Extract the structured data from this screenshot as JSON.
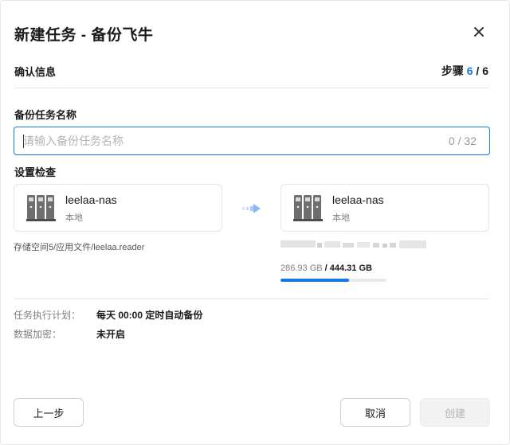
{
  "dialog": {
    "title": "新建任务 - 备份飞牛",
    "close_icon": "close-icon"
  },
  "step": {
    "label": "确认信息",
    "prefix": "步骤",
    "current": "6",
    "separator": "/",
    "total": "6"
  },
  "task_name": {
    "label": "备份任务名称",
    "value": "",
    "placeholder": "请输入备份任务名称",
    "count": "0 / 32"
  },
  "check": {
    "label": "设置检查",
    "source": {
      "name": "leelaa-nas",
      "location": "本地",
      "icon": "server-rack-icon",
      "path": "存储空间5/应用文件/leelaa.reader"
    },
    "arrow_icon": "arrow-right-icon",
    "target": {
      "name": "leelaa-nas",
      "location": "本地",
      "icon": "server-rack-icon",
      "used": "286.93 GB",
      "separator": " / ",
      "total": "444.31 GB",
      "used_fraction": 0.646
    }
  },
  "info": [
    {
      "key": "任务执行计划：",
      "value": "每天 00:00 定时自动备份"
    },
    {
      "key": "数据加密：",
      "value": "未开启"
    }
  ],
  "buttons": {
    "prev": "上一步",
    "cancel": "取消",
    "create": "创建"
  },
  "colors": {
    "accent": "#1677e6",
    "border": "#e6e6e6",
    "muted": "#808080"
  }
}
